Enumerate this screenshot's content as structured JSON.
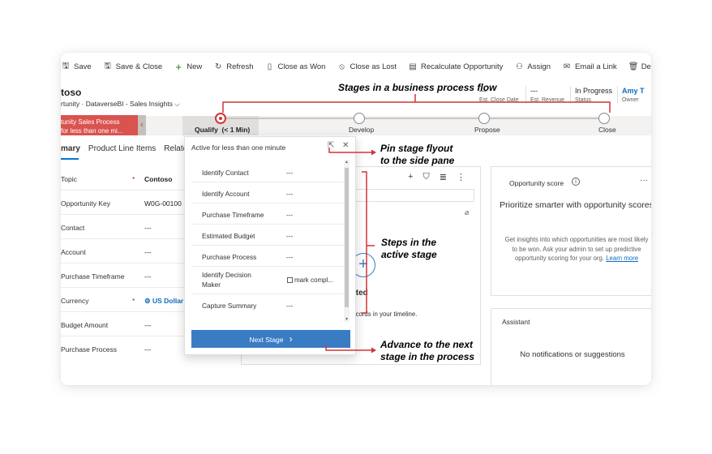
{
  "commands": [
    {
      "label": "Save",
      "icon": "save-icon",
      "glyph": "🖫"
    },
    {
      "label": "Save & Close",
      "icon": "save-close-icon",
      "glyph": "🖫"
    },
    {
      "label": "New",
      "icon": "plus-icon",
      "glyph": "+"
    },
    {
      "label": "Refresh",
      "icon": "refresh-icon",
      "glyph": "↻"
    },
    {
      "label": "Close as Won",
      "icon": "trophy-icon",
      "glyph": "▯"
    },
    {
      "label": "Close as Lost",
      "icon": "cancel-icon",
      "glyph": "⦸"
    },
    {
      "label": "Recalculate Opportunity",
      "icon": "calculator-icon",
      "glyph": "▤"
    },
    {
      "label": "Assign",
      "icon": "person-assign-icon",
      "glyph": "⚇"
    },
    {
      "label": "Email a Link",
      "icon": "email-icon",
      "glyph": "✉"
    },
    {
      "label": "Delete",
      "icon": "trash-icon",
      "glyph": "🗑"
    },
    {
      "label": "",
      "icon": "more-icon",
      "glyph": "⋮"
    }
  ],
  "header": {
    "title": "toso",
    "subtitle": "rtunity · DataverseBI - Sales Insights ⌵",
    "fields": [
      {
        "value": "---",
        "label": "Est. Close Date"
      },
      {
        "value": "---",
        "label": "Est. Revenue"
      },
      {
        "value": "In Progress",
        "label": "Status"
      },
      {
        "value": "Amy T",
        "label": "Owner"
      }
    ]
  },
  "process": {
    "badge_title": "tunity Sales Process",
    "badge_sub": "for less than one mi...",
    "chevron": "‹",
    "stages": [
      {
        "label": "Qualify",
        "duration": "(< 1 Min)",
        "active": true
      },
      {
        "label": "Develop",
        "active": false
      },
      {
        "label": "Propose",
        "active": false
      },
      {
        "label": "Close",
        "active": false
      }
    ]
  },
  "tabs": [
    "mary",
    "Product Line Items",
    "Relate"
  ],
  "form": [
    {
      "label": "Topic",
      "required": true,
      "value": "Contoso",
      "style": "bold"
    },
    {
      "label": "Opportunity Key",
      "required": false,
      "value": "W0G-00100",
      "style": ""
    },
    {
      "label": "Contact",
      "required": false,
      "value": "---",
      "style": ""
    },
    {
      "label": "Account",
      "required": false,
      "value": "---",
      "style": ""
    },
    {
      "label": "Purchase Timeframe",
      "required": false,
      "value": "---",
      "style": ""
    },
    {
      "label": "Currency",
      "required": true,
      "value": "US Dollar",
      "style": "link"
    },
    {
      "label": "Budget Amount",
      "required": false,
      "value": "---",
      "style": ""
    },
    {
      "label": "Purchase Process",
      "required": false,
      "value": "---",
      "style": ""
    }
  ],
  "flyout": {
    "header": "Active for less than one minute",
    "pin_icon": "⇱",
    "close_icon": "✕",
    "steps": [
      {
        "name": "Identify Contact",
        "value": "---"
      },
      {
        "name": "Identify Account",
        "value": "---"
      },
      {
        "name": "Purchase Timeframe",
        "value": "---"
      },
      {
        "name": "Estimated Budget",
        "value": "---"
      },
      {
        "name": "Purchase Process",
        "value": "---"
      },
      {
        "name": "Identify Decision Maker",
        "value": "mark compl..."
      },
      {
        "name": "Capture Summary",
        "value": "---"
      }
    ],
    "next_stage": "Next Stage",
    "next_chevron": "›"
  },
  "timeline": {
    "started": "tarted",
    "desc": "ll records in your timeline.",
    "tool_glyphs": [
      "+",
      "⛉",
      "≣",
      "⋮"
    ],
    "plus_glyph": "+",
    "clip_glyph": "⌀"
  },
  "score": {
    "title": "Opportunity score",
    "info": "i",
    "more": "···",
    "heading": "Prioritize smarter with opportunity scores",
    "body": "Get insights into which opportunities are most likely to be won. Ask your admin to set up predictive opportunity scoring for your org.",
    "link": "Learn more"
  },
  "assistant": {
    "title": "Assistant",
    "body": "No notifications or suggestions"
  },
  "annotations": {
    "stages": "Stages in a business process flow",
    "pin_line1": "Pin stage flyout",
    "pin_line2": "to the side pane",
    "steps_line1": "Steps in the",
    "steps_line2": "active stage",
    "advance_line1": "Advance to the next",
    "advance_line2": "stage in the process"
  },
  "colors": {
    "accent": "#3a7cc4",
    "process_badge": "#d9534f",
    "annotation_red": "#d13438"
  }
}
